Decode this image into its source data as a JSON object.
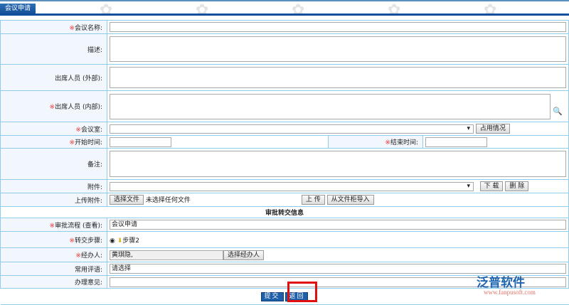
{
  "header": {
    "tab": "会议申请"
  },
  "fields": {
    "name": "会议名称:",
    "desc": "描述:",
    "ext": "出席人员 (外部):",
    "int": "出席人员 (内部):",
    "room": "会议室:",
    "room_btn": "占用情况",
    "start": "开始时间:",
    "end": "结束时间:",
    "remark": "备注:",
    "attach": "附件:",
    "download": "下 载",
    "delete": "删 除",
    "upload_label": "上传附件:",
    "choose_file": "选择文件",
    "no_file": "未选择任何文件",
    "upload": "上 传",
    "import": "从文件柜导入"
  },
  "req_mark": "※",
  "approval": {
    "title": "审批转交信息",
    "flow_label": "审批流程 (查看):",
    "flow_value": "会议申请",
    "step_label": "转交步骤:",
    "step_value": "步骤2",
    "handler_label": "经办人:",
    "handler_value": "黄琪隐,",
    "handler_btn": "选择经办人",
    "comment_label": "常用评语:",
    "comment_value": "请选择",
    "opinion_label": "办理意见:"
  },
  "buttons": {
    "submit": "提交",
    "back": "返回"
  },
  "watermark": {
    "brand": "泛普软件",
    "url": "www.fanpusoft.com"
  }
}
